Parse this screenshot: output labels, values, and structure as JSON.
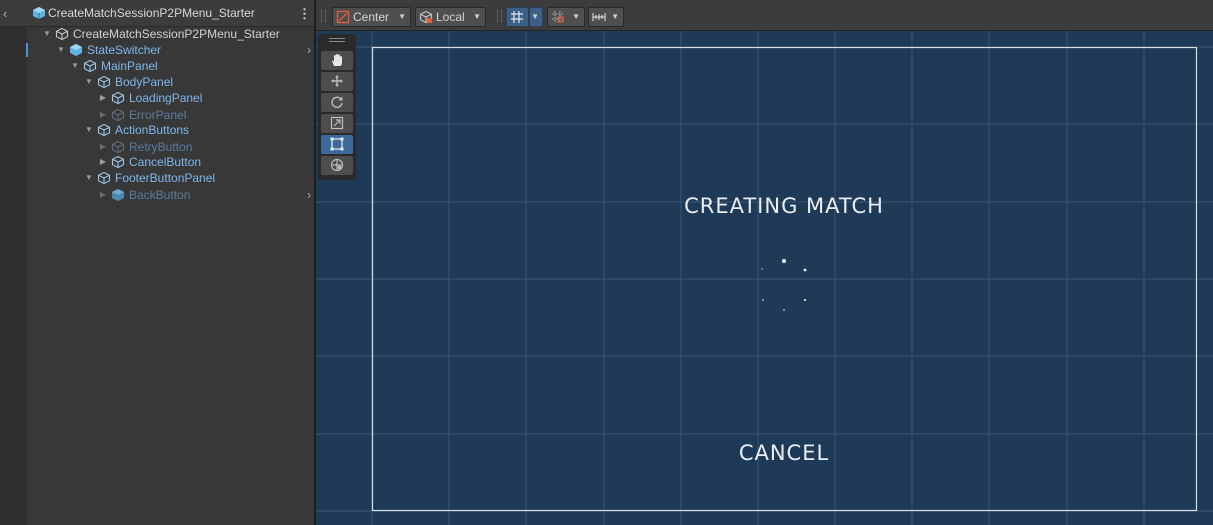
{
  "hierarchy": {
    "title": "CreateMatchSessionP2PMenu_Starter",
    "items": [
      {
        "label": "CreateMatchSessionP2PMenu_Starter"
      },
      {
        "label": "StateSwitcher"
      },
      {
        "label": "MainPanel"
      },
      {
        "label": "BodyPanel"
      },
      {
        "label": "LoadingPanel"
      },
      {
        "label": "ErrorPanel"
      },
      {
        "label": "ActionButtons"
      },
      {
        "label": "RetryButton"
      },
      {
        "label": "CancelButton"
      },
      {
        "label": "FooterButtonPanel"
      },
      {
        "label": "BackButton"
      }
    ]
  },
  "toolbar": {
    "pivot_label": "Center",
    "space_label": "Local"
  },
  "scene": {
    "title_text": "CREATING MATCH",
    "cancel_text": "CANCEL"
  },
  "colors": {
    "canvas_bg": "#1f3a57",
    "prefab_text": "#7fb6ec",
    "active_tool": "#3e6a9b"
  },
  "icons": {
    "tools": [
      "hand-icon",
      "move-icon",
      "rotate-icon",
      "scale-icon",
      "rect-transform-icon",
      "transform-icon"
    ]
  }
}
